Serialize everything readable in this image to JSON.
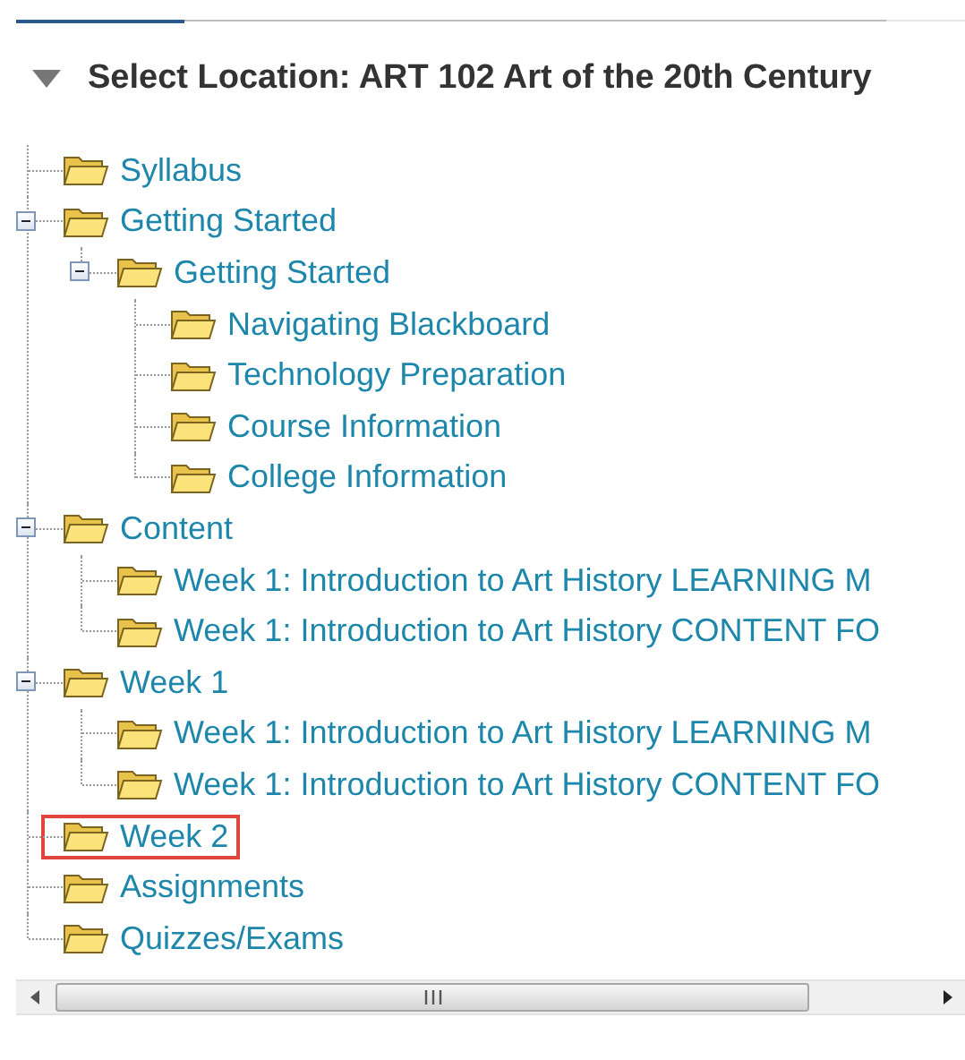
{
  "header": {
    "title": "Select Location: ART 102 Art of the 20th Century"
  },
  "tree": [
    {
      "label": "Syllabus",
      "highlighted": false
    },
    {
      "label": "Getting Started",
      "highlighted": false,
      "expanded": true,
      "children": [
        {
          "label": "Getting Started",
          "highlighted": false,
          "expanded": true,
          "children": [
            {
              "label": "Navigating Blackboard",
              "highlighted": false
            },
            {
              "label": "Technology Preparation",
              "highlighted": false
            },
            {
              "label": "Course Information",
              "highlighted": false
            },
            {
              "label": "College Information",
              "highlighted": false
            }
          ]
        }
      ]
    },
    {
      "label": "Content",
      "highlighted": false,
      "expanded": true,
      "children": [
        {
          "label": "Week 1: Introduction to Art History LEARNING M",
          "highlighted": false
        },
        {
          "label": "Week 1: Introduction to Art History CONTENT FO",
          "highlighted": false
        }
      ]
    },
    {
      "label": "Week 1",
      "highlighted": false,
      "expanded": true,
      "children": [
        {
          "label": "Week 1: Introduction to Art History LEARNING M",
          "highlighted": false
        },
        {
          "label": "Week 1: Introduction to Art History CONTENT FO",
          "highlighted": false
        }
      ]
    },
    {
      "label": "Week 2",
      "highlighted": true
    },
    {
      "label": "Assignments",
      "highlighted": false
    },
    {
      "label": "Quizzes/Exams",
      "highlighted": false
    }
  ]
}
